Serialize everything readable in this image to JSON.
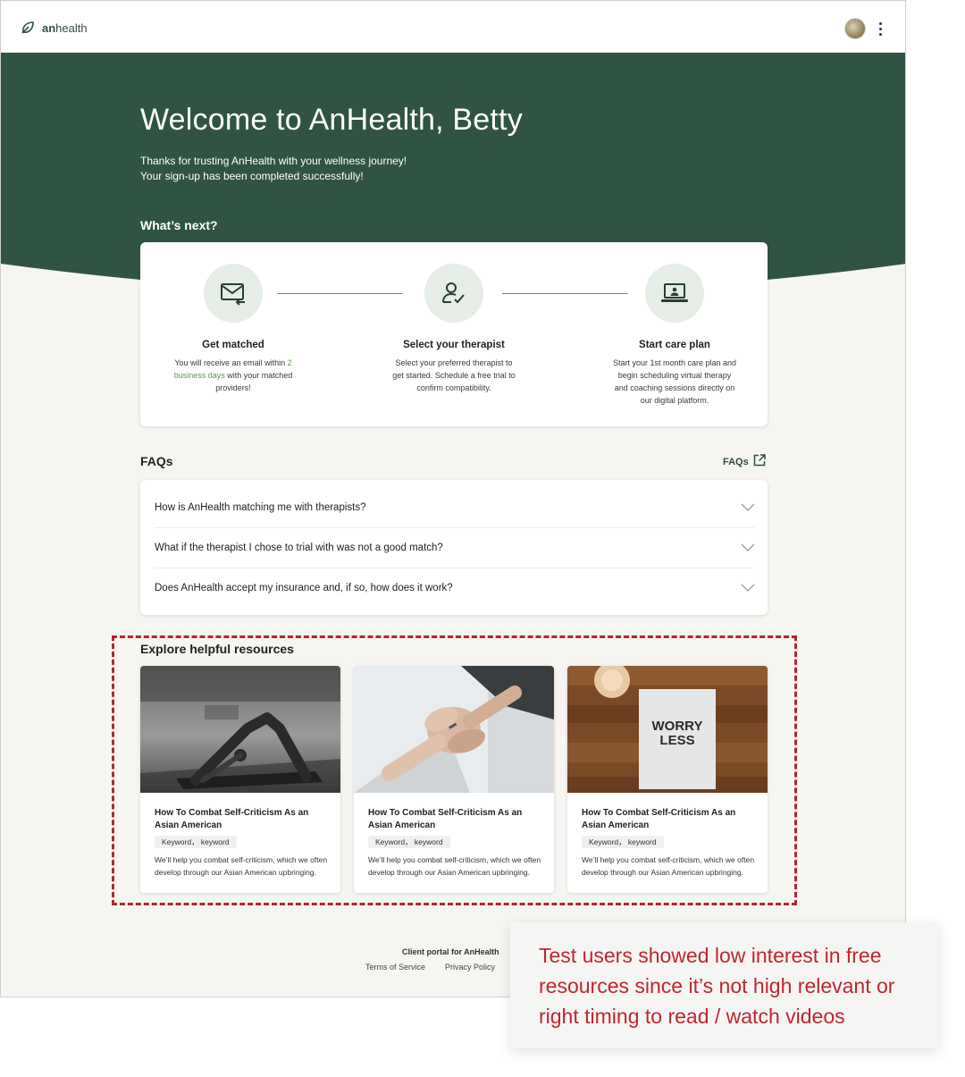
{
  "app": {
    "logo_bold": "an",
    "logo_rest": "health"
  },
  "hero": {
    "title": "Welcome to AnHealth, Betty",
    "subtitle_line1": "Thanks for trusting AnHealth with your wellness journey!",
    "subtitle_line2": "Your sign-up has been completed successfully!",
    "whats_next": "What’s next?"
  },
  "steps": [
    {
      "icon": "envelope-icon",
      "title": "Get matched",
      "desc_before": "You will receive an email within",
      "desc_highlight": "2 business days",
      "desc_after": " with your matched providers!"
    },
    {
      "icon": "user-check-icon",
      "title": "Select your therapist",
      "desc": "Select your preferred therapist to get started. Schedule a free trial to confirm compatibility."
    },
    {
      "icon": "laptop-icon",
      "title": "Start care plan",
      "desc": "Start your 1st month care plan and begin scheduling virtual therapy and coaching sessions directly on our digital platform."
    }
  ],
  "faqs": {
    "title": "FAQs",
    "link_label": "FAQs",
    "items": [
      "How is AnHealth matching me with therapists?",
      "What if the therapist I chose to trial with was not a good match?",
      "Does AnHealth accept my insurance and, if so, how does it work?"
    ]
  },
  "resources": {
    "title": "Explore helpful resources",
    "cards": [
      {
        "image": "yoga-photo",
        "title": "How To Combat Self-Criticism As an Asian American",
        "tag": "Keyword， keyword",
        "desc": "We’ll help you combat self-criticism, which we often develop through our Asian American upbringing."
      },
      {
        "image": "holding-hands-photo",
        "title": "How To Combat Self-Criticism As an Asian American",
        "tag": "Keyword， keyword",
        "desc": "We’ll help you combat self-criticism, which we often develop through our Asian American upbringing."
      },
      {
        "image": "worry-less-photo",
        "image_text_line1": "WORRY",
        "image_text_line2": "LESS",
        "title": "How To Combat Self-Criticism As an Asian American",
        "tag": "Keyword， keyword",
        "desc": "We’ll help you combat self-criticism, which we often develop through our Asian American upbringing."
      }
    ]
  },
  "footer": {
    "title": "Client portal for AnHealth",
    "terms": "Terms of Service",
    "privacy": "Privacy Policy"
  },
  "annotation": {
    "text": "Test users showed low interest in free resources since it’s not high relevant or right timing to read / watch videos"
  },
  "colors": {
    "brand_green": "#2f5443",
    "highlight_green": "#5b9a45",
    "annotation_red": "#c0262d"
  }
}
